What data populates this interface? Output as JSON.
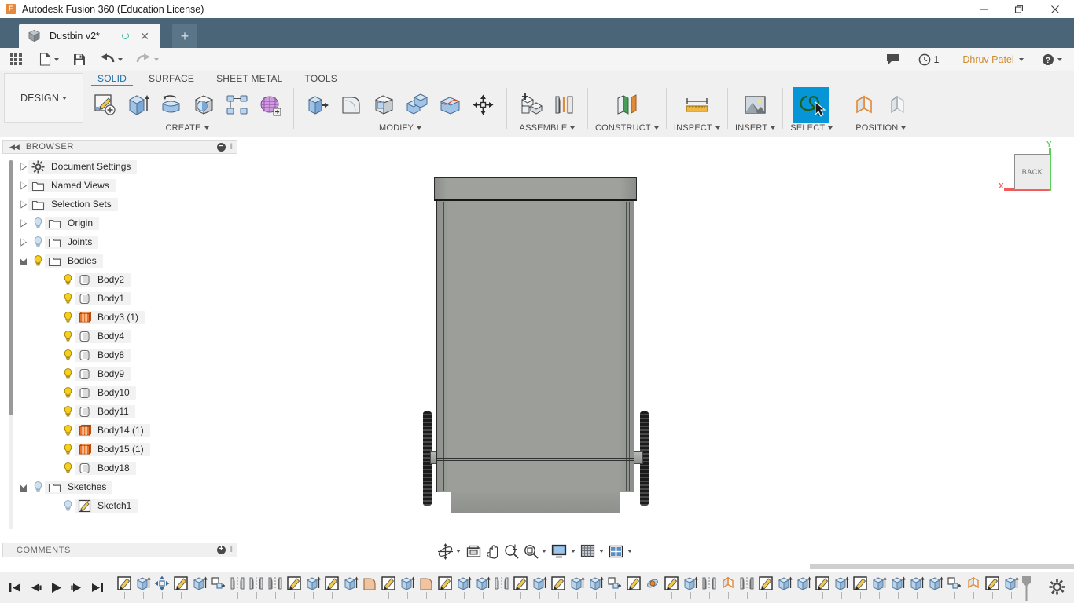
{
  "window": {
    "app_title": "Autodesk Fusion 360 (Education License)",
    "logo_letter": "F",
    "minimize": "minimize-button",
    "maximize": "maximize-button",
    "close": "close-button"
  },
  "tabs": {
    "document_tab": "Dustbin v2*",
    "new_tab_label": "+"
  },
  "quick_access": {
    "grid_icon": "app-grid-icon",
    "file_icon": "file-icon",
    "save_icon": "save-icon",
    "undo_icon": "undo-icon",
    "redo_icon": "redo-icon",
    "comment_icon": "comment-icon",
    "history_icon": "history-icon",
    "history_count": "1",
    "user_name": "Dhruv Patel",
    "help_icon": "help-icon"
  },
  "ribbon": {
    "workspace": "DESIGN",
    "tabs": [
      {
        "label": "SOLID",
        "active": true
      },
      {
        "label": "SURFACE",
        "active": false
      },
      {
        "label": "SHEET METAL",
        "active": false
      },
      {
        "label": "TOOLS",
        "active": false
      }
    ],
    "panels": [
      {
        "label": "CREATE",
        "has_dropdown": true,
        "tools": [
          {
            "name": "create-sketch-icon",
            "selected": false
          },
          {
            "name": "extrude-icon",
            "selected": false
          },
          {
            "name": "revolve-icon",
            "selected": false
          },
          {
            "name": "sphere-icon",
            "selected": false
          },
          {
            "name": "pattern-icon",
            "selected": false
          },
          {
            "name": "create-form-icon",
            "selected": false
          }
        ]
      },
      {
        "label": "MODIFY",
        "has_dropdown": true,
        "tools": [
          {
            "name": "press-pull-icon",
            "selected": false
          },
          {
            "name": "fillet-icon",
            "selected": false
          },
          {
            "name": "shell-icon",
            "selected": false
          },
          {
            "name": "combine-icon",
            "selected": false
          },
          {
            "name": "split-face-icon",
            "selected": false
          },
          {
            "name": "move-copy-icon",
            "selected": false
          }
        ]
      },
      {
        "label": "ASSEMBLE",
        "has_dropdown": true,
        "tools": [
          {
            "name": "new-component-icon",
            "selected": false
          },
          {
            "name": "joint-icon",
            "selected": false
          }
        ]
      },
      {
        "label": "CONSTRUCT",
        "has_dropdown": true,
        "tools": [
          {
            "name": "offset-plane-icon",
            "selected": false
          }
        ]
      },
      {
        "label": "INSPECT",
        "has_dropdown": true,
        "tools": [
          {
            "name": "measure-icon",
            "selected": false
          }
        ]
      },
      {
        "label": "INSERT",
        "has_dropdown": true,
        "tools": [
          {
            "name": "insert-image-icon",
            "selected": false
          }
        ]
      },
      {
        "label": "SELECT",
        "has_dropdown": true,
        "tools": [
          {
            "name": "select-lasso-icon",
            "selected": true
          }
        ]
      },
      {
        "label": "POSITION",
        "has_dropdown": true,
        "tools": [
          {
            "name": "align-icon",
            "selected": false
          },
          {
            "name": "position-ghost-icon",
            "selected": false
          }
        ]
      }
    ]
  },
  "browser": {
    "header": "BROWSER",
    "collapse_icon": "collapse-left-icon",
    "minimize_icon": "minimize-panel-icon",
    "items": [
      {
        "label": "Document Settings",
        "arrow": "closed",
        "bulb": false,
        "icon": "gear-icon",
        "indent": 0
      },
      {
        "label": "Named Views",
        "arrow": "closed",
        "bulb": false,
        "icon": "folder-icon",
        "indent": 0
      },
      {
        "label": "Selection Sets",
        "arrow": "closed",
        "bulb": false,
        "icon": "folder-icon",
        "indent": 0
      },
      {
        "label": "Origin",
        "arrow": "closed",
        "bulb": true,
        "bulb_dim": true,
        "icon": "folder-icon",
        "indent": 0
      },
      {
        "label": "Joints",
        "arrow": "closed",
        "bulb": true,
        "bulb_dim": true,
        "icon": "folder-icon",
        "indent": 0
      },
      {
        "label": "Bodies",
        "arrow": "open",
        "bulb": true,
        "bulb_dim": false,
        "icon": "folder-icon",
        "indent": 0
      },
      {
        "label": "Body2",
        "arrow": "none",
        "bulb": true,
        "icon": "body-icon",
        "indent": 1
      },
      {
        "label": "Body1",
        "arrow": "none",
        "bulb": true,
        "icon": "body-icon",
        "indent": 1
      },
      {
        "label": "Body3 (1)",
        "arrow": "none",
        "bulb": true,
        "icon": "body-orange-icon",
        "indent": 1
      },
      {
        "label": "Body4",
        "arrow": "none",
        "bulb": true,
        "icon": "body-icon",
        "indent": 1
      },
      {
        "label": "Body8",
        "arrow": "none",
        "bulb": true,
        "icon": "body-icon",
        "indent": 1
      },
      {
        "label": "Body9",
        "arrow": "none",
        "bulb": true,
        "icon": "body-icon",
        "indent": 1
      },
      {
        "label": "Body10",
        "arrow": "none",
        "bulb": true,
        "icon": "body-icon",
        "indent": 1
      },
      {
        "label": "Body11",
        "arrow": "none",
        "bulb": true,
        "icon": "body-icon",
        "indent": 1
      },
      {
        "label": "Body14 (1)",
        "arrow": "none",
        "bulb": true,
        "icon": "body-orange-icon",
        "indent": 1
      },
      {
        "label": "Body15 (1)",
        "arrow": "none",
        "bulb": true,
        "icon": "body-orange-icon",
        "indent": 1
      },
      {
        "label": "Body18",
        "arrow": "none",
        "bulb": true,
        "icon": "body-icon",
        "indent": 1
      },
      {
        "label": "Sketches",
        "arrow": "open",
        "bulb": true,
        "bulb_dim": true,
        "icon": "folder-icon",
        "indent": 0
      },
      {
        "label": "Sketch1",
        "arrow": "none",
        "bulb": true,
        "bulb_dim": true,
        "icon": "sketch-icon",
        "indent": 1
      }
    ]
  },
  "viewport": {
    "view_cube_face": "BACK",
    "axis_x_label": "X",
    "axis_y_label": "Y",
    "axis_x_color": "#f05a5a",
    "axis_y_color": "#5ad05a",
    "model_name": "dustbin-model",
    "nav_tools": [
      {
        "name": "orbit-icon",
        "dropdown": true
      },
      {
        "name": "look-at-icon",
        "dropdown": false
      },
      {
        "name": "pan-icon",
        "dropdown": false
      },
      {
        "name": "zoom-icon",
        "dropdown": false
      },
      {
        "name": "fit-icon",
        "dropdown": true
      },
      {
        "name": "display-settings-icon",
        "dropdown": true
      },
      {
        "name": "grid-snap-icon",
        "dropdown": true
      },
      {
        "name": "viewports-icon",
        "dropdown": true
      }
    ]
  },
  "comments": {
    "header": "COMMENTS",
    "add_icon": "add-comment-icon"
  },
  "timeline": {
    "playback": [
      {
        "name": "go-to-beginning-button"
      },
      {
        "name": "step-back-button"
      },
      {
        "name": "play-button"
      },
      {
        "name": "step-forward-button"
      },
      {
        "name": "go-to-end-button"
      }
    ],
    "features": [
      "sketch",
      "extrude",
      "move",
      "sketch",
      "extrude",
      "rect-pattern",
      "mirror",
      "mirror",
      "mirror",
      "sketch",
      "extrude",
      "sketch",
      "extrude",
      "fillet",
      "sketch",
      "extrude",
      "fillet",
      "sketch",
      "extrude",
      "extrude",
      "mirror",
      "sketch",
      "extrude",
      "sketch",
      "extrude",
      "extrude",
      "rect-pattern",
      "sketch",
      "revolve",
      "sketch",
      "extrude",
      "mirror",
      "align",
      "mirror",
      "sketch",
      "extrude",
      "extrude",
      "sketch",
      "extrude",
      "sketch",
      "extrude",
      "extrude",
      "extrude",
      "extrude",
      "rect-pattern",
      "align",
      "sketch",
      "extrude"
    ],
    "settings_icon": "timeline-settings-icon"
  }
}
